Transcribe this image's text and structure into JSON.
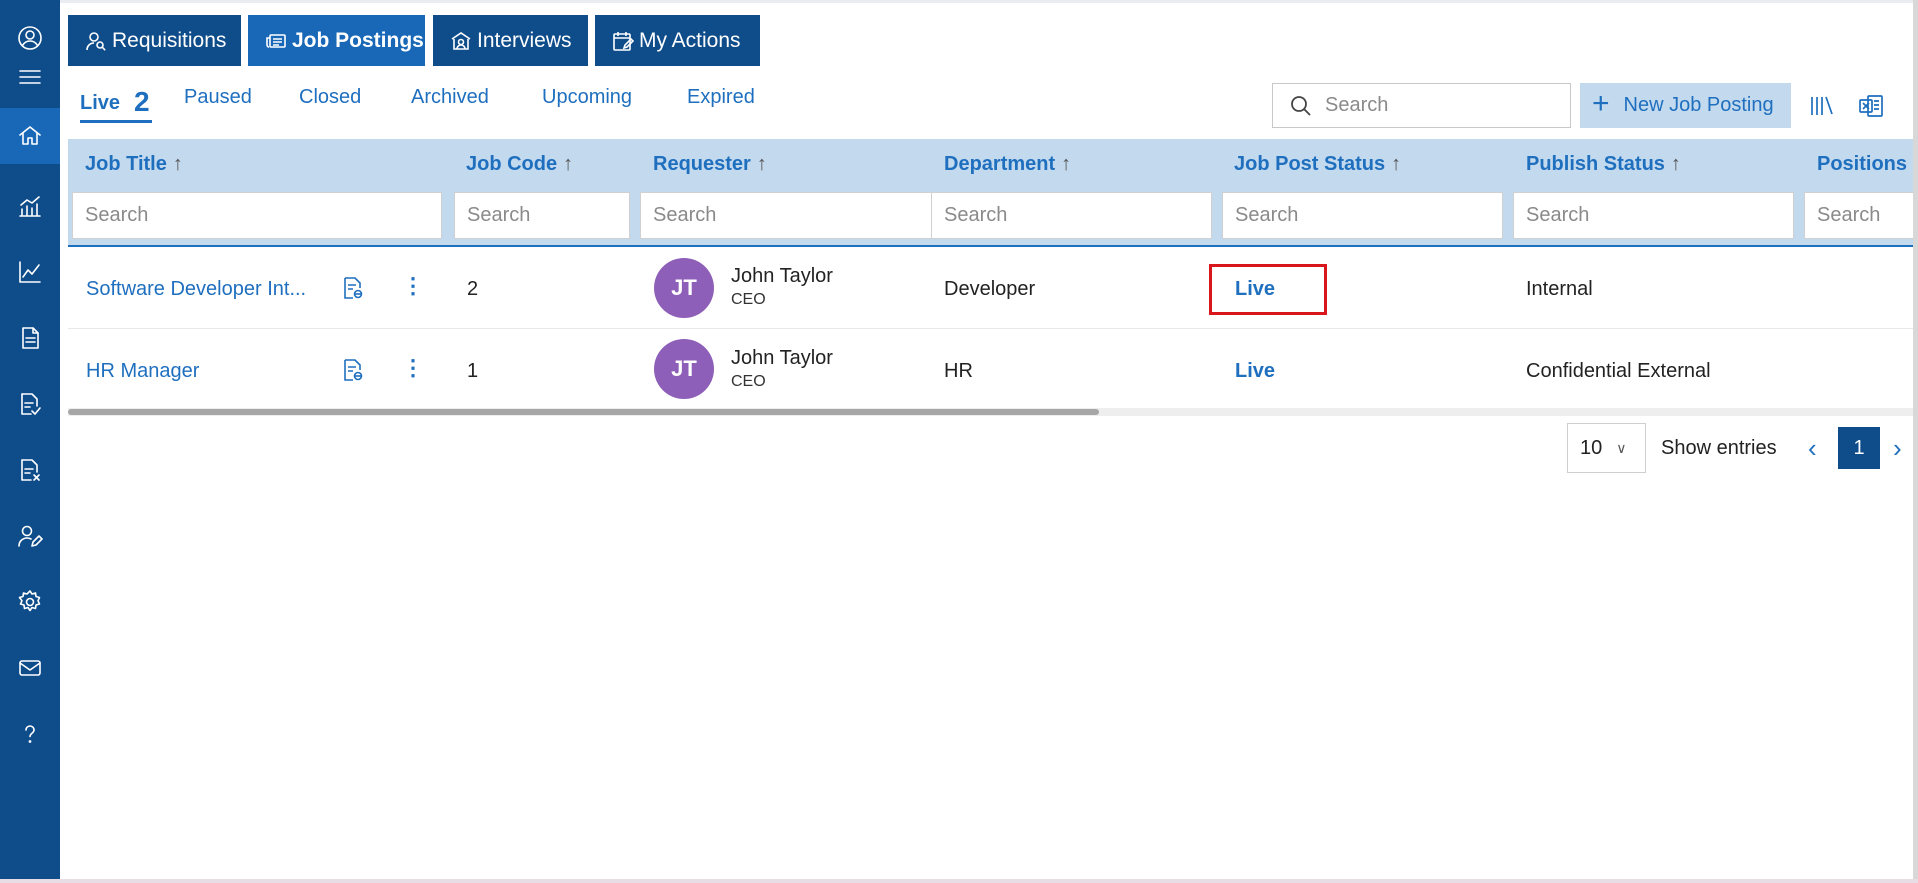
{
  "sidebar": {
    "items": [
      {
        "icon": "home-icon",
        "active": true
      },
      {
        "icon": "analytics-icon"
      },
      {
        "icon": "line-chart-icon"
      },
      {
        "icon": "document-icon"
      },
      {
        "icon": "document-check-icon"
      },
      {
        "icon": "document-cancel-icon"
      },
      {
        "icon": "user-edit-icon"
      },
      {
        "icon": "gear-icon"
      },
      {
        "icon": "mail-icon"
      },
      {
        "icon": "help-icon"
      }
    ]
  },
  "top_tabs": [
    {
      "label": "Requisitions",
      "icon": "user-search-icon"
    },
    {
      "label": "Job Postings",
      "icon": "newspaper-icon",
      "active": true
    },
    {
      "label": "Interviews",
      "icon": "meeting-icon"
    },
    {
      "label": "My Actions",
      "icon": "calendar-edit-icon"
    }
  ],
  "sub_tabs": [
    {
      "label": "Live",
      "count": "2",
      "active": true
    },
    {
      "label": "Paused"
    },
    {
      "label": "Closed"
    },
    {
      "label": "Archived"
    },
    {
      "label": "Upcoming"
    },
    {
      "label": "Expired"
    }
  ],
  "toolbar": {
    "search_placeholder": "Search",
    "new_button_plus": "+",
    "new_button_label": "New Job Posting"
  },
  "table": {
    "columns": [
      {
        "label": "Job Title",
        "arrow": "↑",
        "filter_placeholder": "Search"
      },
      {
        "label": "Job Code",
        "arrow": "↑",
        "filter_placeholder": "Search"
      },
      {
        "label": "Requester",
        "arrow": "↑",
        "filter_placeholder": "Search"
      },
      {
        "label": "Department",
        "arrow": "↑",
        "filter_placeholder": "Search"
      },
      {
        "label": "Job Post Status",
        "arrow": "↑",
        "filter_placeholder": "Search"
      },
      {
        "label": "Publish Status",
        "arrow": "↑",
        "filter_placeholder": "Search"
      },
      {
        "label": "Positions",
        "arrow": "↑",
        "filter_placeholder": "Search"
      }
    ],
    "rows": [
      {
        "job_title": "Software Developer Int...",
        "job_code": "2",
        "avatar_initials": "JT",
        "requester_name": "John Taylor",
        "requester_role": "CEO",
        "department": "Developer",
        "job_post_status": "Live",
        "publish_status": "Internal",
        "kebab": "⋮"
      },
      {
        "job_title": "HR Manager",
        "job_code": "1",
        "avatar_initials": "JT",
        "requester_name": "John Taylor",
        "requester_role": "CEO",
        "department": "HR",
        "job_post_status": "Live",
        "publish_status": "Confidential External",
        "kebab": "⋮"
      }
    ]
  },
  "pagination": {
    "page_size": "10",
    "show_entries_label": "Show entries",
    "prev": "‹",
    "current_page": "1",
    "next": "›"
  },
  "colors": {
    "sidebar": "#0f4c8a",
    "active_tab": "#1868b7",
    "accent": "#1f6fbf",
    "header_bg": "#c3d9ee",
    "avatar": "#8e5fb8",
    "highlight_box": "#d9161c"
  }
}
